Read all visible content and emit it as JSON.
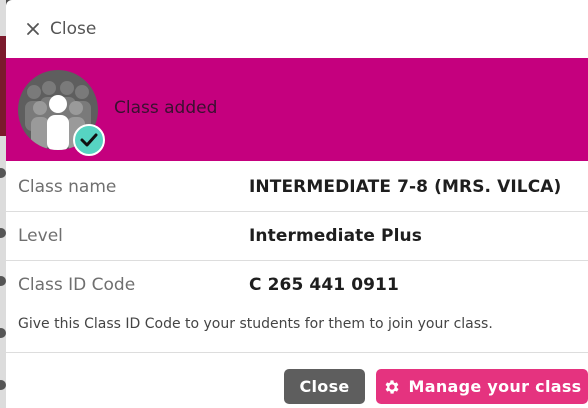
{
  "header": {
    "close_label": "Close",
    "close_icon": "close-x-icon"
  },
  "banner": {
    "message": "Class added",
    "color": "#c5007e",
    "avatar_icon": "class-group-avatar-icon",
    "badge_icon": "checkmark-badge-icon",
    "badge_color": "#56d4c2"
  },
  "details": [
    {
      "label": "Class name",
      "value": "INTERMEDIATE 7-8 (MRS. VILCA)"
    },
    {
      "label": "Level",
      "value": "Intermediate Plus"
    },
    {
      "label": "Class ID Code",
      "value": "C 265 441 0911"
    }
  ],
  "note": "Give this Class ID Code to your students for them to join your class.",
  "footer": {
    "close_button_label": "Close",
    "manage_button_label": "Manage your class",
    "manage_icon": "gear-icon",
    "close_button_color": "#5e5e5e",
    "manage_button_color": "#e5337f"
  }
}
